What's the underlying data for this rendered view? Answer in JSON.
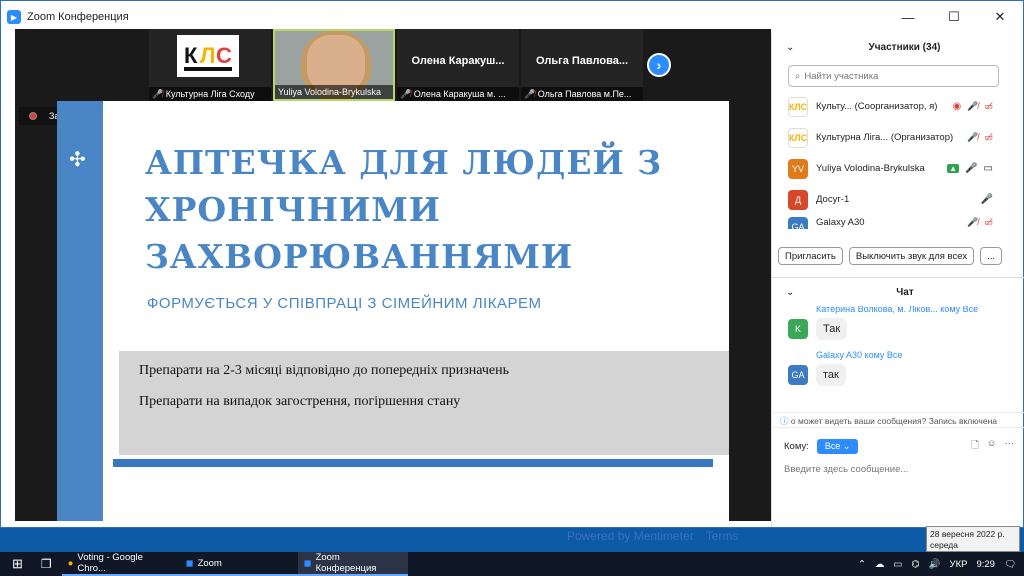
{
  "window": {
    "title": "Zoom Конференция",
    "minimize": "—",
    "maximize": "☐",
    "close": "✕"
  },
  "thumbs": [
    {
      "name": "Культурна Ліга Сходу",
      "type": "logo",
      "logo_text": "КЛС"
    },
    {
      "name": "Yuliya Volodina-Brykulska",
      "type": "video"
    },
    {
      "name": "Олена Каракуша м. ...",
      "big": "Олена Каракуш...",
      "type": "name"
    },
    {
      "name": "Ольга Павлова м.Пе...",
      "big": "Ольга Павлова...",
      "type": "name"
    }
  ],
  "next_icon": "›",
  "recording": {
    "label": "Запись..."
  },
  "slide": {
    "title": "АПТЕЧКА ДЛЯ ЛЮДЕЙ З ХРОНІЧНИМИ ЗАХВОРЮВАННЯМИ",
    "subtitle": "ФОРМУЄТЬСЯ У СПІВПРАЦІ З СІМЕЙНИМ ЛІКАРЕМ",
    "line1": "Препарати на 2-3 місяці відповідно до попередніх призначень",
    "line2": "Препарати на випадок загострення, погіршення стану",
    "accent": "#4a86c5"
  },
  "mentimeter": {
    "powered": "Powered by Mentimeter",
    "terms": "Terms"
  },
  "participants": {
    "header": "Участники (34)",
    "search_placeholder": "Найти участника",
    "list": [
      {
        "initials": "",
        "color": "#ffffff",
        "name": "Культу... (Соорганизатор, я)",
        "mic": "muted",
        "cam": "off"
      },
      {
        "initials": "",
        "color": "#ffffff",
        "name": "Культурна Ліга... (Организатор)",
        "mic": "muted",
        "cam": "off"
      },
      {
        "initials": "YV",
        "color": "#e07b1a",
        "name": "Yuliya Volodina-Brykulska",
        "mic": "on",
        "cam": "on"
      },
      {
        "initials": "Д",
        "color": "#d9472b",
        "name": "Досуг-1",
        "mic": "on",
        "cam": ""
      },
      {
        "initials": "GA",
        "color": "#3b7bbf",
        "name": "Galaxy A30",
        "mic": "muted",
        "cam": "off"
      }
    ],
    "invite": "Пригласить",
    "mute_all": "Выключить звук для всех",
    "more": "..."
  },
  "chat": {
    "header": "Чат",
    "messages": [
      {
        "meta": "Катерина Волкова, м. Ліков... кому Все",
        "initials": "K",
        "color": "#3aa856",
        "text": "Так"
      },
      {
        "meta": "Galaxy A30 кому Все",
        "initials": "GA",
        "color": "#3b7bbf",
        "text": "так"
      }
    ],
    "notice": "о может видеть ваши сообщения? Запись включена",
    "to_label": "Кому:",
    "to_value": "Все",
    "placeholder": "Введите здесь сообщение..."
  },
  "taskbar": {
    "items": [
      {
        "label": "Voting - Google Chro...",
        "state": "open"
      },
      {
        "label": "Zoom",
        "state": "open"
      },
      {
        "label": "Zoom Конференция",
        "state": "active"
      }
    ],
    "lang": "УКР",
    "time": "9:29"
  },
  "tooltip": {
    "date": "28 вересня 2022 р.",
    "day": "середа"
  }
}
